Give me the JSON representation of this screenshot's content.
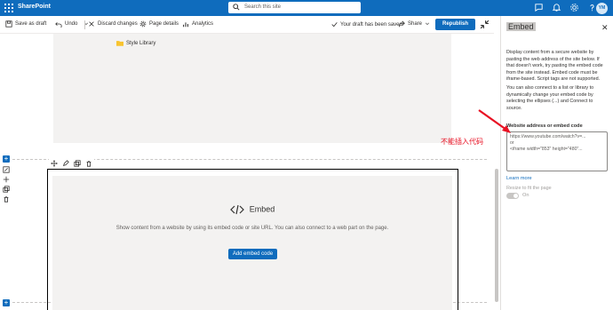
{
  "suitebar": {
    "app_name": "SharePoint",
    "search_placeholder": "Search this site",
    "avatar_initials": "YM",
    "color": "#0f6cbd"
  },
  "toolbar": {
    "save_draft": "Save as draft",
    "undo": "Undo",
    "discard": "Discard changes",
    "page_details": "Page details",
    "analytics": "Analytics",
    "draft_status": "Your draft has been saved",
    "share": "Share",
    "republish": "Republish"
  },
  "canvas": {
    "style_library": "Style Library",
    "embed": {
      "title": "Embed",
      "description": "Show content from a website by using its embed code or site URL. You can also connect to a web part on the page.",
      "button": "Add embed code"
    }
  },
  "pane": {
    "title": "Embed",
    "description1": "Display content from a secure website by pasting the web address of the site below. If that doesn't work, try pasting the embed code from the site instead. Embed code must be iframe-based. Script tags are not supported.",
    "description2": "You can also connect to a list or library to dynamically change your embed code by selecting the ellipses (...) and Connect to source.",
    "field_label": "Website address or embed code",
    "field_placeholder": "https://www.youtube.com/watch?v=...\nor\n<iframe width=\"853\" height=\"480\"...",
    "learn_more": "Learn more",
    "resize_label": "Resize to fit the page",
    "toggle_state": "On"
  },
  "annotation": {
    "text": "不能插入代码",
    "color": "#e81123"
  }
}
